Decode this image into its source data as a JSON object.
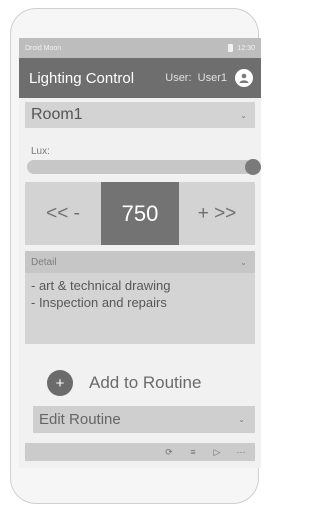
{
  "status_bar": {
    "carrier": "Droid Moon",
    "time": "12:30"
  },
  "app_bar": {
    "title": "Lighting Control",
    "user_prefix": "User:",
    "user_name": "User1",
    "avatar_icon": "person-icon"
  },
  "room_select": {
    "value": "Room1"
  },
  "lux": {
    "label": "Lux:",
    "level": 1.0
  },
  "stepper": {
    "dec_label": "<< -",
    "value": "750",
    "inc_label": "+ >>"
  },
  "detail": {
    "label": "Detail",
    "lines": [
      "- art & technical drawing",
      "- Inspection and repairs"
    ]
  },
  "add_routine": {
    "label": "Add to Routine",
    "icon_glyph": "+"
  },
  "edit_routine": {
    "value": "Edit Routine"
  },
  "bottom_bar": {
    "icons": [
      "refresh-icon",
      "list-icon",
      "play-icon",
      "more-icon"
    ]
  }
}
